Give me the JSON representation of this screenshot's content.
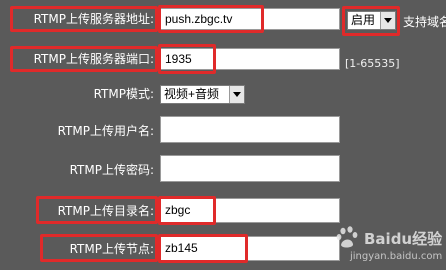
{
  "form": {
    "server_address": {
      "label": "RTMP上传服务器地址:",
      "value": "push.zbgc.tv"
    },
    "enable_select": {
      "value": "启用"
    },
    "domain_support_hint": "支持域名",
    "server_port": {
      "label": "RTMP上传服务器端口:",
      "value": "1935",
      "range_hint": "[1-65535]"
    },
    "mode": {
      "label": "RTMP模式:",
      "value": "视频+音频"
    },
    "username": {
      "label": "RTMP上传用户名:",
      "value": ""
    },
    "password": {
      "label": "RTMP上传密码:",
      "value": ""
    },
    "directory": {
      "label": "RTMP上传目录名:",
      "value": "zbgc"
    },
    "node": {
      "label": "RTMP上传节点:",
      "value": "zb145"
    }
  },
  "watermark": {
    "brand": "Baidu经验",
    "url": "jingyan.baidu.com"
  },
  "colors": {
    "background": "#5a5a5a",
    "highlight": "#e02a2a"
  }
}
